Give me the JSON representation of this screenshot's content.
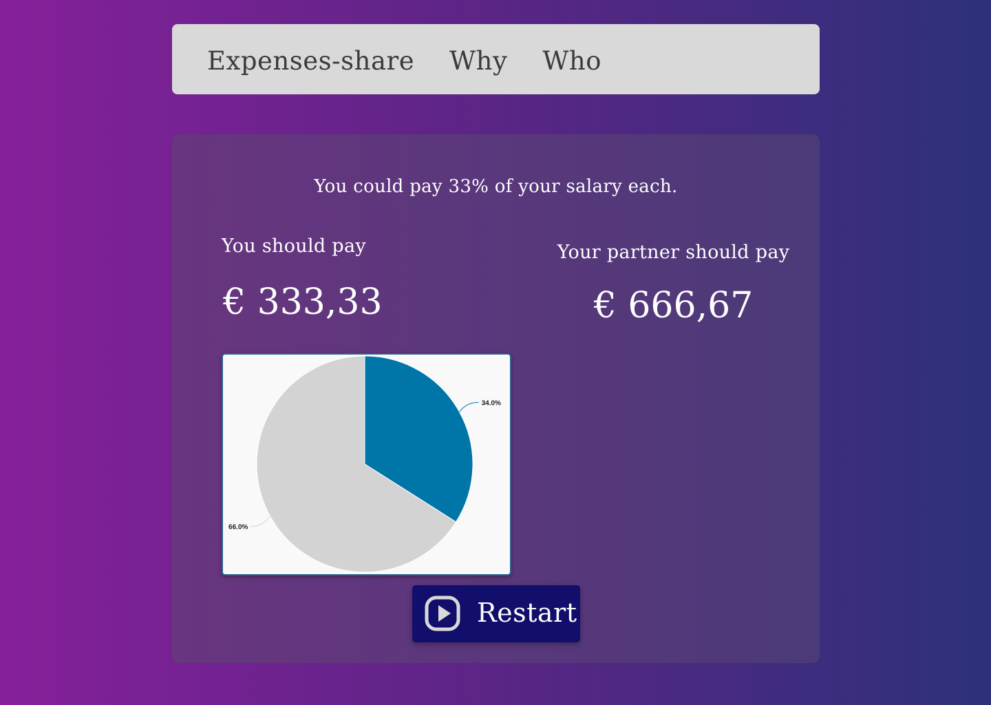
{
  "nav": {
    "brand": "Expenses-share",
    "links": [
      "Why",
      "Who"
    ]
  },
  "result": {
    "summary": "You could pay 33% of your salary each.",
    "you_label": "You should pay",
    "you_amount": "€ 333,33",
    "partner_label": "Your partner should pay",
    "partner_amount": "€ 666,67"
  },
  "restart_button": {
    "label": "Restart",
    "icon": "play-circle-icon"
  },
  "colors": {
    "background_gradient_start": "#86209a",
    "background_gradient_end": "#2d317a",
    "navbar": "#d9d9d9",
    "card": "#633a80",
    "slice_you": "#0075a8",
    "slice_partner": "#d3d3d3",
    "button": "#110f6b"
  },
  "chart_data": {
    "type": "pie",
    "slices": [
      {
        "value": 34.0,
        "label": "34.0%",
        "color": "#0075a8"
      },
      {
        "value": 66.0,
        "label": "66.0%",
        "color": "#d3d3d3"
      }
    ]
  }
}
